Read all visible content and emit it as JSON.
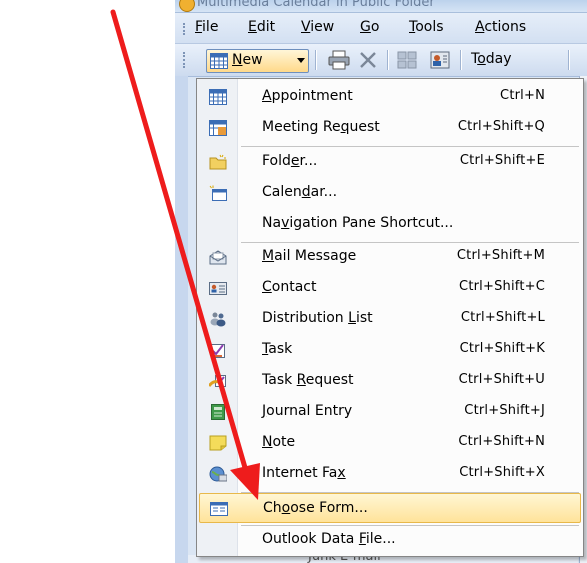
{
  "window": {
    "title": "Multimedia Calendar in Public Folder"
  },
  "menubar": {
    "items": [
      {
        "pre": "",
        "u": "F",
        "post": "ile"
      },
      {
        "pre": "",
        "u": "E",
        "post": "dit"
      },
      {
        "pre": "",
        "u": "V",
        "post": "iew"
      },
      {
        "pre": "",
        "u": "G",
        "post": "o"
      },
      {
        "pre": "",
        "u": "T",
        "post": "ools"
      },
      {
        "pre": "",
        "u": "A",
        "post": "ctions"
      }
    ]
  },
  "toolbar": {
    "new_label_u": "N",
    "new_label_rest": "ew",
    "today_pre": "T",
    "today_u": "o",
    "today_post": "day"
  },
  "menu": {
    "items": [
      {
        "pre": "",
        "u": "A",
        "post": "ppointment",
        "shortcut": "Ctrl+N",
        "icon": "appointment-icon"
      },
      {
        "pre": "Meeting Re",
        "u": "q",
        "post": "uest",
        "shortcut": "Ctrl+Shift+Q",
        "icon": "meeting-request-icon"
      },
      {
        "pre": "Fold",
        "u": "e",
        "post": "r...",
        "shortcut": "Ctrl+Shift+E",
        "icon": "folder-icon"
      },
      {
        "pre": "Calen",
        "u": "d",
        "post": "ar...",
        "shortcut": "",
        "icon": "calendar-icon"
      },
      {
        "pre": "Na",
        "u": "v",
        "post": "igation Pane Shortcut...",
        "shortcut": "",
        "icon": ""
      },
      {
        "pre": "",
        "u": "M",
        "post": "ail Message",
        "shortcut": "Ctrl+Shift+M",
        "icon": "mail-message-icon"
      },
      {
        "pre": "",
        "u": "C",
        "post": "ontact",
        "shortcut": "Ctrl+Shift+C",
        "icon": "contact-icon"
      },
      {
        "pre": "Distribution ",
        "u": "L",
        "post": "ist",
        "shortcut": "Ctrl+Shift+L",
        "icon": "distribution-list-icon"
      },
      {
        "pre": "",
        "u": "T",
        "post": "ask",
        "shortcut": "Ctrl+Shift+K",
        "icon": "task-icon"
      },
      {
        "pre": "Task ",
        "u": "R",
        "post": "equest",
        "shortcut": "Ctrl+Shift+U",
        "icon": "task-request-icon"
      },
      {
        "pre": "",
        "u": "J",
        "post": "ournal Entry",
        "shortcut": "Ctrl+Shift+J",
        "icon": "journal-entry-icon"
      },
      {
        "pre": "",
        "u": "N",
        "post": "ote",
        "shortcut": "Ctrl+Shift+N",
        "icon": "note-icon"
      },
      {
        "pre": "Internet Fa",
        "u": "x",
        "post": "",
        "shortcut": "Ctrl+Shift+X",
        "icon": "internet-fax-icon"
      },
      {
        "pre": "Ch",
        "u": "o",
        "post": "ose Form...",
        "shortcut": "",
        "icon": "choose-form-icon",
        "highlighted": true
      },
      {
        "pre": "Outlook Data ",
        "u": "F",
        "post": "ile...",
        "shortcut": "",
        "icon": ""
      }
    ]
  },
  "bottom": {
    "partial_text": "Junk E-mail"
  },
  "colors": {
    "arrow": "#ee1c1c",
    "highlight": "#ffe39a"
  }
}
